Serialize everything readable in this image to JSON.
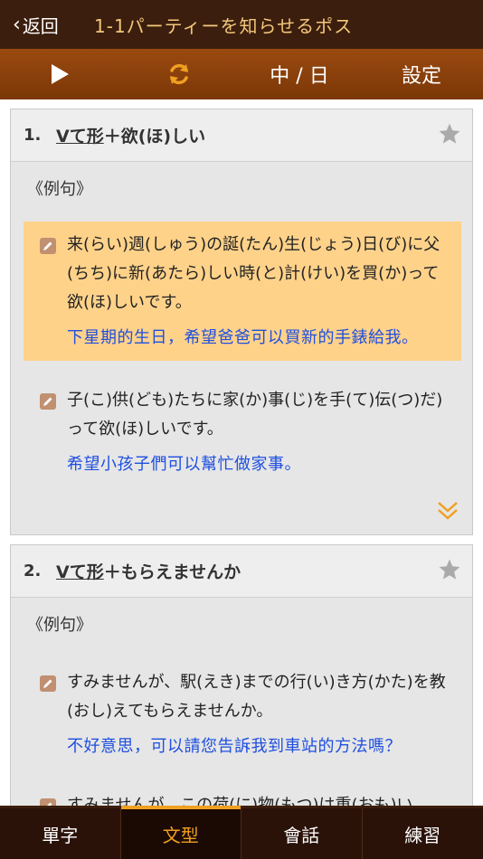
{
  "header": {
    "back_label": "返回",
    "title": "1-1パーティーを知らせるポス⁠"
  },
  "toolbar": {
    "language_label": "中 / 日",
    "settings_label": "設定"
  },
  "colors": {
    "accent": "#f0a020",
    "highlight": "#ffd28a",
    "translation": "#1f4fe0"
  },
  "cards": [
    {
      "number": "1.",
      "title_prefix": "Vて形",
      "title_rest": "＋欲(ほ)しい",
      "section_label": "《例句》",
      "examples": [
        {
          "jp": "来(らい)週(しゅう)の誕(たん)生(じょう)日(び)に父(ちち)に新(あたら)しい時(と)計(けい)を買(か)って欲(ほ)しいです。",
          "zh": "下星期的生日，希望爸爸可以買新的手錶給我。"
        },
        {
          "jp": "子(こ)供(ども)たちに家(か)事(じ)を手(て)伝(つ)だ)って欲(ほ)しいです。",
          "zh": "希望小孩子們可以幫忙做家事。"
        }
      ]
    },
    {
      "number": "2.",
      "title_prefix": "Vて形",
      "title_rest": "＋もらえませんか",
      "section_label": "《例句》",
      "examples": [
        {
          "jp": "すみませんが、駅(えき)までの行(い)き方(かた)を教(おし)えてもらえませんか。",
          "zh": "不好意思，可以請您告訴我到車站的方法嗎？"
        },
        {
          "jp": "すみませんが、この荷(に)物(もつ)は重(おも)い",
          "zh": ""
        }
      ]
    }
  ],
  "tabs": [
    {
      "label": "單字",
      "active": false
    },
    {
      "label": "文型",
      "active": true
    },
    {
      "label": "會話",
      "active": false
    },
    {
      "label": "練習",
      "active": false
    }
  ]
}
